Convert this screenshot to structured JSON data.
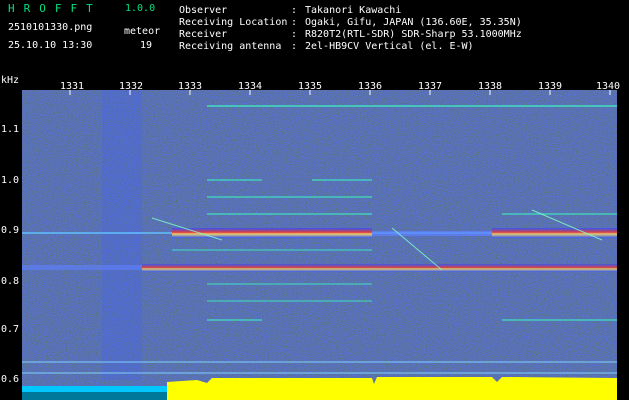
{
  "header": {
    "app_title": "HROFFT",
    "app_version": "1.0.0",
    "filename": "2510101330.png",
    "datetime": "25.10.10 13:30",
    "detect_label": "meteor",
    "detect_count": "19"
  },
  "info": [
    {
      "key": "Observer",
      "value": "Takanori Kawachi"
    },
    {
      "key": "Receiving Location",
      "value": "Ogaki, Gifu, JAPAN (136.60E, 35.35N)"
    },
    {
      "key": "Receiver",
      "value": "R820T2(RTL-SDR) SDR-Sharp 53.1000MHz"
    },
    {
      "key": "Receiving antenna",
      "value": "2el-HB9CV Vertical (el. E-W)"
    }
  ],
  "axis": {
    "y_unit": "kHz",
    "x_ticks": [
      "1331",
      "1332",
      "1333",
      "1334",
      "1335",
      "1336",
      "1337",
      "1338",
      "1339",
      "1340"
    ],
    "y_ticks": [
      "1.1",
      "1.0",
      "0.9",
      "0.8",
      "0.7",
      "0.6"
    ]
  },
  "colors": {
    "background": "#000000",
    "spectrogram_base": "#0a1478",
    "signal_band": "#ff3020",
    "level_bar": "#ffff00",
    "level_base": "#00c8ff",
    "title": "#00e080"
  }
}
